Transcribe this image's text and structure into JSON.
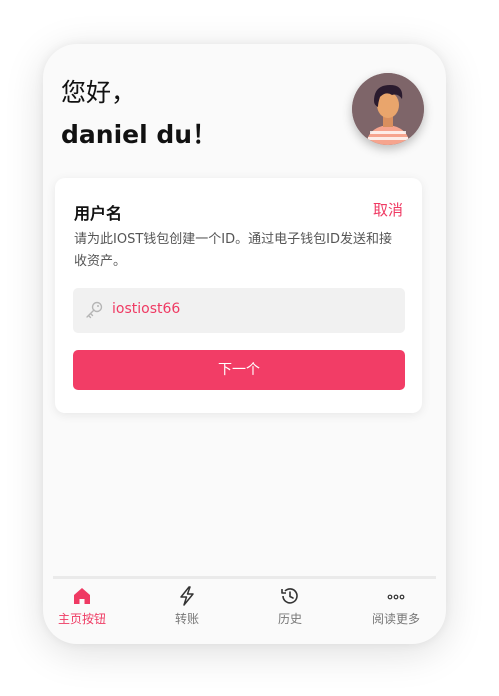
{
  "greeting": {
    "line1": "您好，",
    "line2": "daniel du！"
  },
  "card": {
    "title": "用户名",
    "cancel_label": "取消",
    "description": "请为此IOST钱包创建一个ID。通过电子钱包ID发送和接收资产。",
    "input_value": "iostiost66",
    "next_label": "下一个"
  },
  "tabbar": {
    "items": [
      {
        "label": "主页按钮",
        "icon": "home-icon",
        "active": true
      },
      {
        "label": "转账",
        "icon": "lightning-icon",
        "active": false
      },
      {
        "label": "历史",
        "icon": "history-icon",
        "active": false
      },
      {
        "label": "阅读更多",
        "icon": "more-icon",
        "active": false
      }
    ]
  },
  "colors": {
    "accent": "#f23d66",
    "text": "#111111",
    "muted": "#777777",
    "background": "#fafafa"
  }
}
